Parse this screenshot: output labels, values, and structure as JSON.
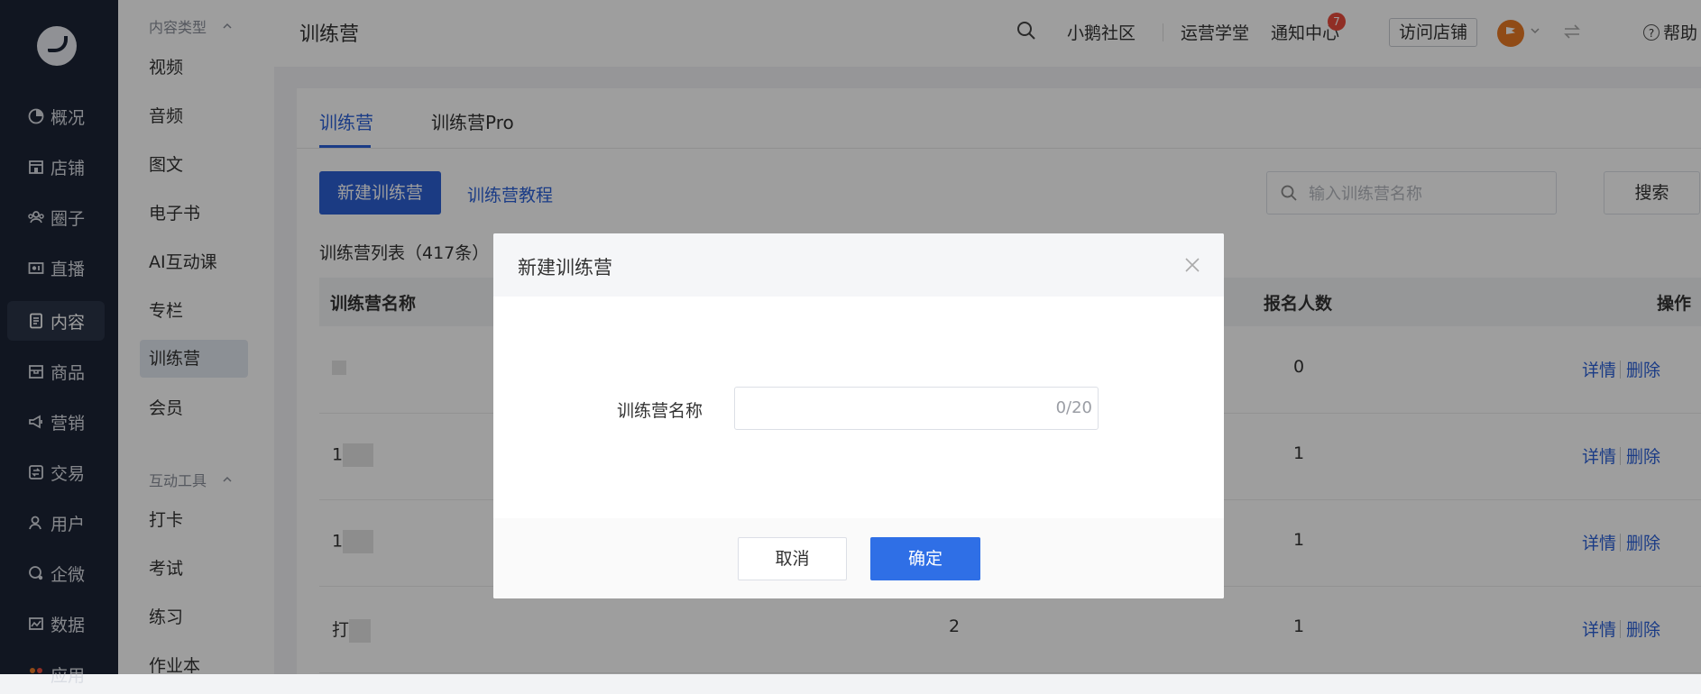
{
  "nav": {
    "items": [
      {
        "label": "概况",
        "icon": "dashboard-icon"
      },
      {
        "label": "店铺",
        "icon": "store-icon"
      },
      {
        "label": "圈子",
        "icon": "community-icon"
      },
      {
        "label": "直播",
        "icon": "live-icon"
      },
      {
        "label": "内容",
        "icon": "content-icon",
        "active": true
      },
      {
        "label": "商品",
        "icon": "goods-icon"
      },
      {
        "label": "营销",
        "icon": "marketing-icon"
      },
      {
        "label": "交易",
        "icon": "trade-icon"
      },
      {
        "label": "用户",
        "icon": "user-icon"
      },
      {
        "label": "企微",
        "icon": "wecom-icon"
      },
      {
        "label": "数据",
        "icon": "data-icon"
      },
      {
        "label": "应用",
        "icon": "apps-icon"
      }
    ]
  },
  "submenu": {
    "group1": "内容类型",
    "items1": [
      "视频",
      "音频",
      "图文",
      "电子书",
      "AI互动课",
      "专栏",
      "训练营",
      "会员"
    ],
    "active": "训练营",
    "group2": "互动工具",
    "items2": [
      "打卡",
      "考试",
      "练习",
      "作业本"
    ]
  },
  "header": {
    "title": "训练营",
    "links": [
      "小鹅社区",
      "运营学堂",
      "通知中心"
    ],
    "notify_count": "7",
    "visit_store": "访问店铺",
    "help": "帮助"
  },
  "main": {
    "tabs": [
      {
        "label": "训练营",
        "active": true
      },
      {
        "label": "训练营Pro"
      }
    ],
    "new_button": "新建训练营",
    "tutorial_link": "训练营教程",
    "search_placeholder": "输入训练营名称",
    "search_button": "搜索",
    "list_title": "训练营列表（417条）",
    "columns": {
      "name": "训练营名称",
      "enroll": "报名人数",
      "ops": "操作"
    },
    "rows": [
      {
        "name": "",
        "col_mid": "",
        "enroll": "0"
      },
      {
        "name": "1",
        "col_mid": "",
        "enroll": "1"
      },
      {
        "name": "1",
        "col_mid": "",
        "enroll": "1"
      },
      {
        "name": "打",
        "col_mid": "2",
        "enroll": "1"
      }
    ],
    "op_detail": "详情",
    "op_delete": "删除"
  },
  "modal": {
    "title": "新建训练营",
    "field_label": "训练营名称",
    "field_value": "",
    "counter": "0/20",
    "cancel": "取消",
    "confirm": "确定"
  },
  "colors": {
    "accent": "#2f6fe6",
    "nav_bg": "#1c2436",
    "badge": "#e84b3c"
  }
}
